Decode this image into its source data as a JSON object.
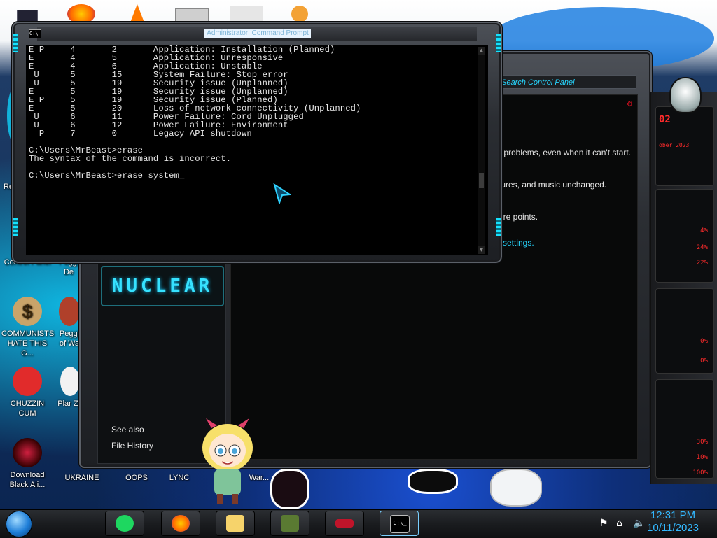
{
  "colors": {
    "accent_cyan": "#27d6ff",
    "console_bg": "#000000",
    "meter_red": "#ff2b2b",
    "clock_blue": "#33b8ff"
  },
  "desktop_icons": [
    {
      "label": "Control Panel",
      "icon": "control-panel-icon"
    },
    {
      "label": "Peggl De",
      "icon": "peggle-icon"
    },
    {
      "label": "COMMUNISTS HATE THIS G...",
      "icon": "money-bag-icon"
    },
    {
      "label": "Peggl of Wa",
      "icon": "peggle-icon"
    },
    {
      "label": "CHUZZIN CUM",
      "icon": "chuzzle-icon"
    },
    {
      "label": "Plar Zo",
      "icon": "plants-icon"
    },
    {
      "label": "Download Black Ali...",
      "icon": "alienware-icon"
    },
    {
      "label": "UKRAINE",
      "icon": "folder-icon"
    },
    {
      "label": "OOPS",
      "icon": "file-icon"
    },
    {
      "label": "LYNC",
      "icon": "file-icon"
    },
    {
      "label": "War...",
      "icon": "file-icon"
    },
    {
      "label": "Re",
      "icon": "recycle-icon"
    }
  ],
  "cmd": {
    "title": "Administrator: Command Prompt",
    "lines": [
      "E P     4       2       Application: Installation (Planned)",
      "E       4       5       Application: Unresponsive",
      "E       4       6       Application: Unstable",
      " U      5       15      System Failure: Stop error",
      " U      5       19      Security issue (Unplanned)",
      "E       5       19      Security issue (Unplanned)",
      "E P     5       19      Security issue (Planned)",
      "E       5       20      Loss of network connectivity (Unplanned)",
      " U      6       11      Power Failure: Cord Unplugged",
      " U      6       12      Power Failure: Environment",
      "  P     7       0       Legacy API shutdown",
      "",
      "C:\\Users\\MrBeast>erase",
      "The syntax of the command is incorrect.",
      "",
      "C:\\Users\\MrBeast>erase system_"
    ]
  },
  "control_panel": {
    "search_placeholder": "Search Control Panel",
    "texts": [
      "r problems, even when it can't start.",
      "tures, and music unchanged.",
      "ore points."
    ],
    "link_text": "settings.",
    "brand": "NUCLEAR",
    "see_also": "See also",
    "file_history": "File History"
  },
  "meter": {
    "header": "02",
    "sub": "ober 2023",
    "percents": [
      "4%",
      "24%",
      "22%",
      "0%",
      "0%",
      "30%",
      "10%",
      "100%"
    ]
  },
  "taskbar": {
    "apps": [
      {
        "name": "Spotify",
        "icon": "spotify-icon"
      },
      {
        "name": "Firefox",
        "icon": "firefox-icon"
      },
      {
        "name": "File Explorer",
        "icon": "folder-icon"
      },
      {
        "name": "Minecraft",
        "icon": "minecraft-icon"
      },
      {
        "name": "Car",
        "icon": "car-icon"
      },
      {
        "name": "Command Prompt",
        "icon": "cmd-icon"
      }
    ],
    "time": "12:31 PM",
    "date": "10/11/2023"
  }
}
